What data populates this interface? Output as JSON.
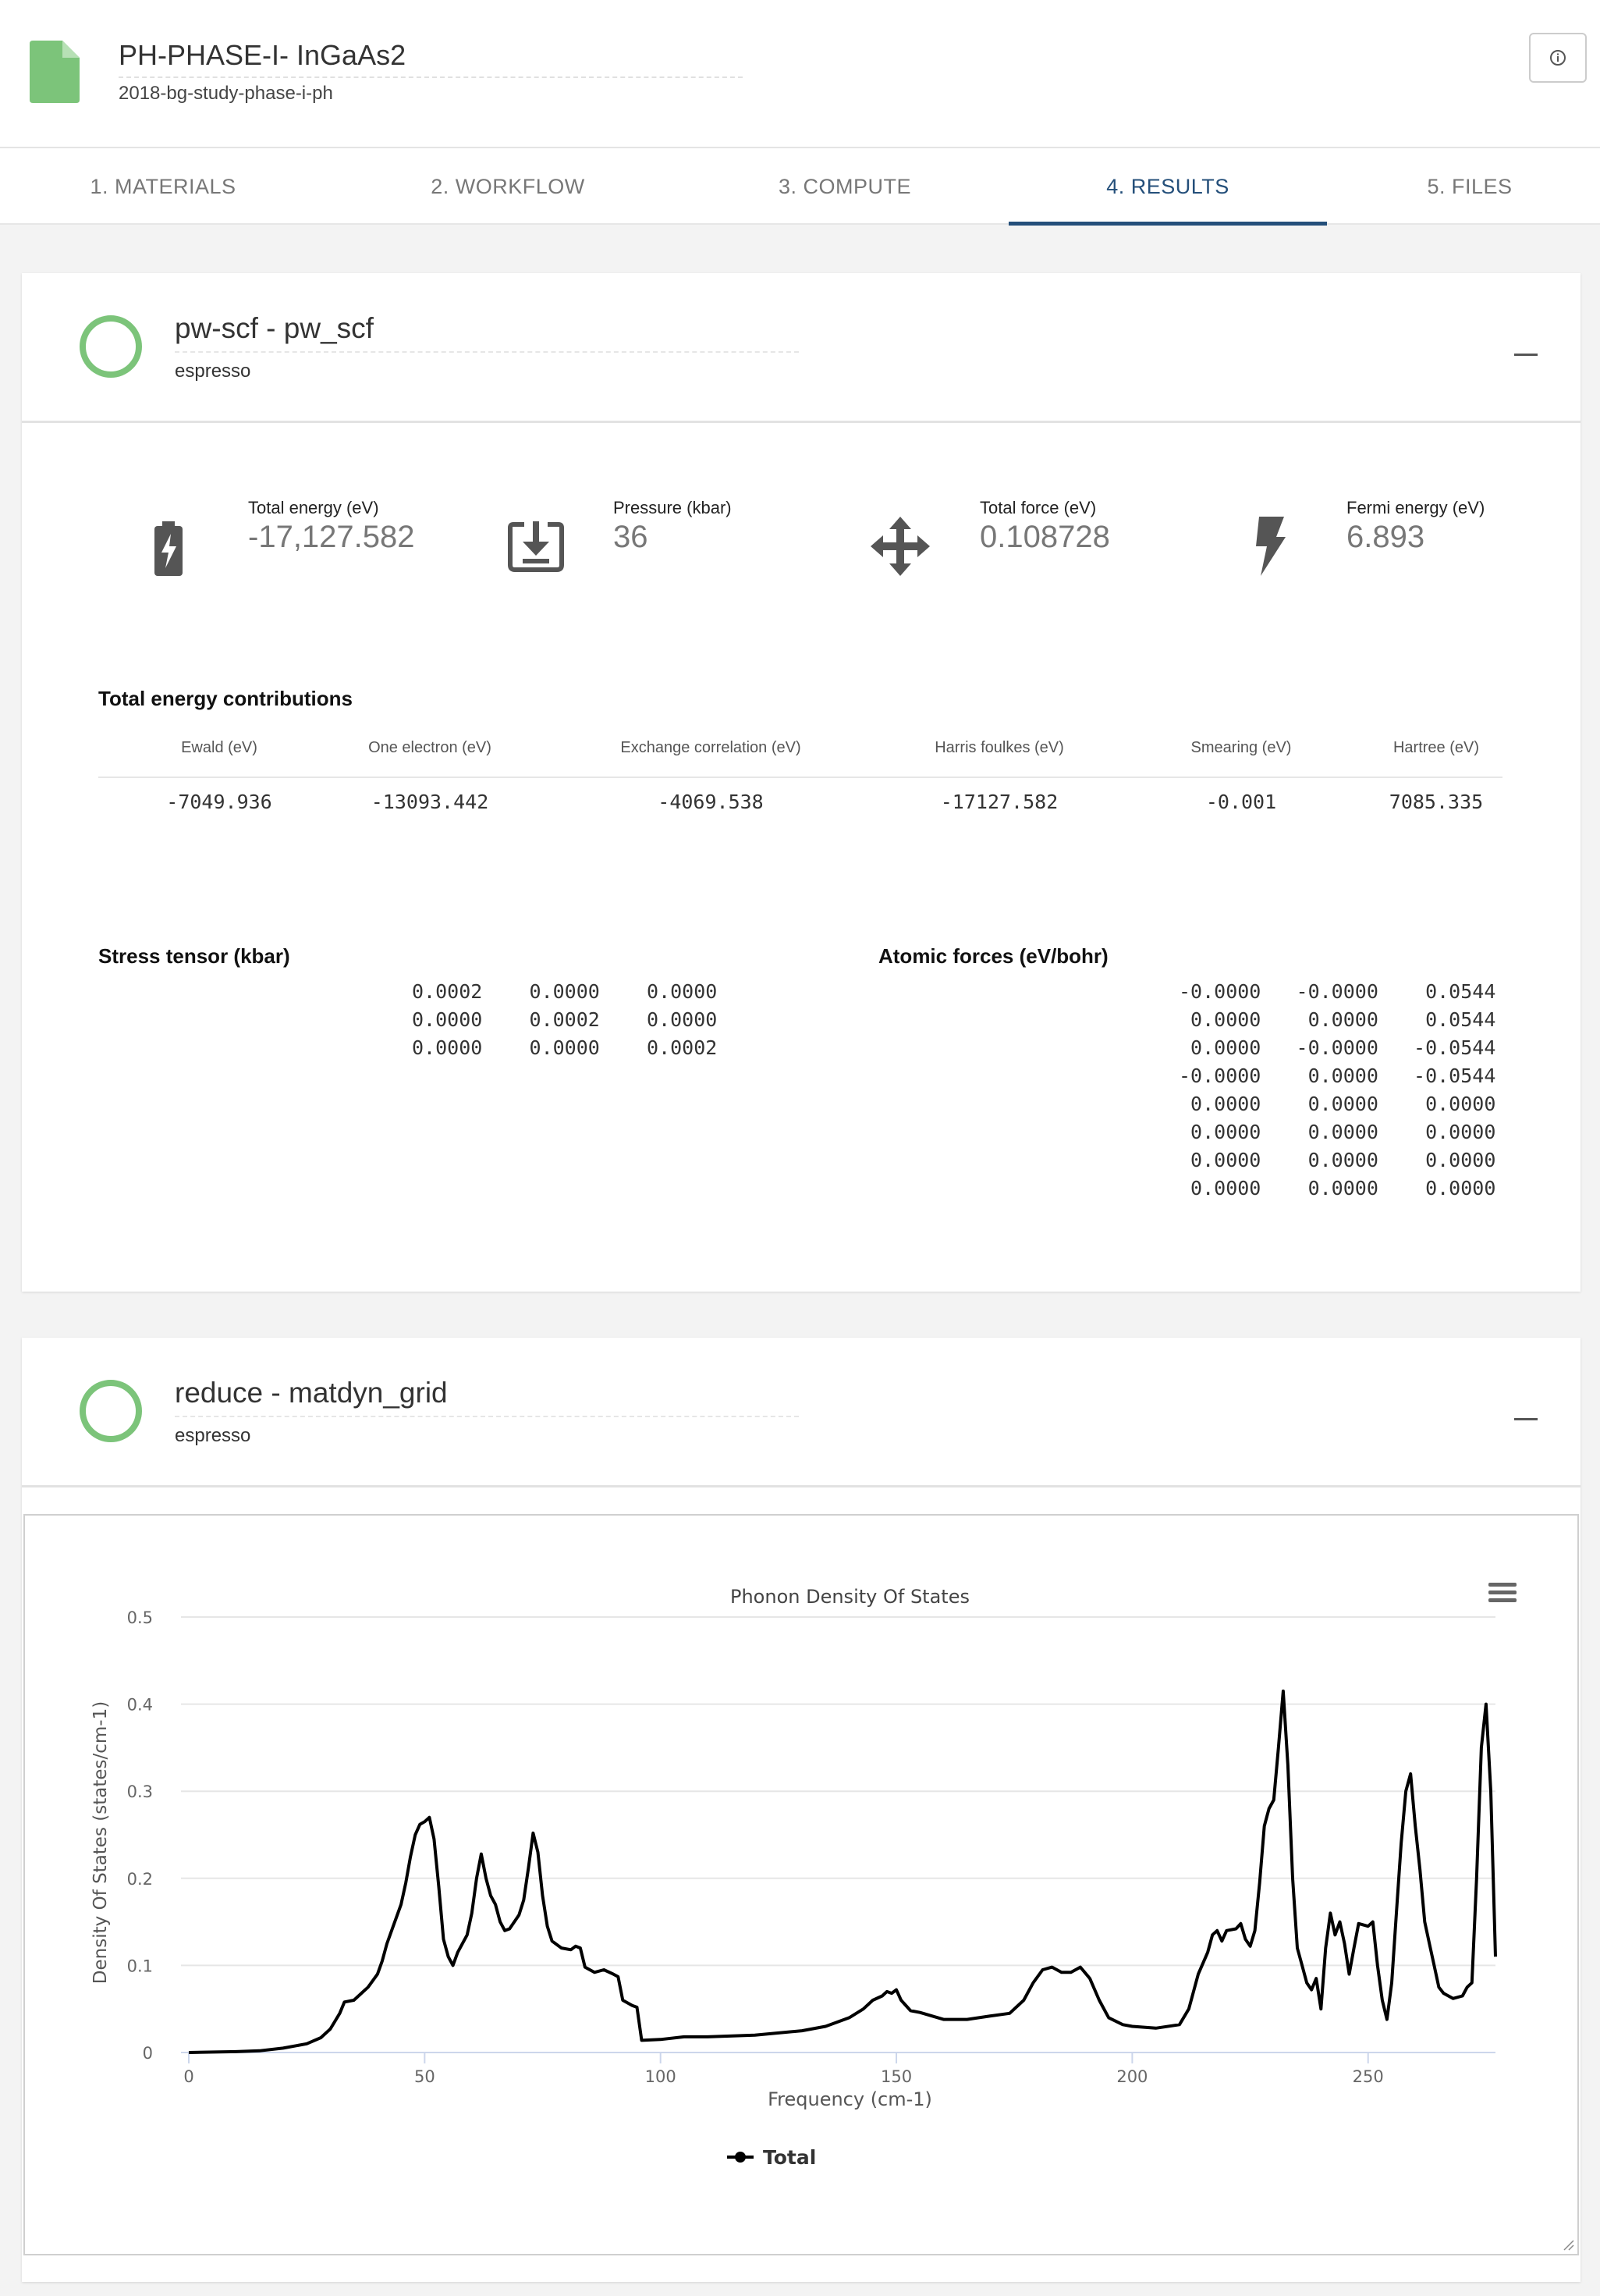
{
  "header": {
    "title": "PH-PHASE-I- InGaAs2",
    "subtitle": "2018-bg-study-phase-i-ph",
    "info_icon": "info-icon"
  },
  "tabs": [
    {
      "label": "1. MATERIALS"
    },
    {
      "label": "2. WORKFLOW"
    },
    {
      "label": "3. COMPUTE"
    },
    {
      "label": "4. RESULTS",
      "active": true
    },
    {
      "label": "5. FILES"
    }
  ],
  "colors": {
    "accent": "#244f7a",
    "status_ok": "#7cc47a",
    "file_icon": "#7cc47a"
  },
  "unit1": {
    "title": "pw-scf - pw_scf",
    "subtitle": "espresso",
    "stats": [
      {
        "label": "Total energy (eV)",
        "value": "-17,127.582",
        "icon": "battery-bolt-icon"
      },
      {
        "label": "Pressure (kbar)",
        "value": "36",
        "icon": "download-box-icon"
      },
      {
        "label": "Total force (eV)",
        "value": "0.108728",
        "icon": "move-arrows-icon"
      },
      {
        "label": "Fermi energy (eV)",
        "value": "6.893",
        "icon": "lightning-icon"
      }
    ],
    "energy_title": "Total energy contributions",
    "energy_headers": [
      "Ewald (eV)",
      "One electron (eV)",
      "Exchange correlation (eV)",
      "Harris foulkes (eV)",
      "Smearing (eV)",
      "Hartree (eV)"
    ],
    "energy_values": [
      "-7049.936",
      "-13093.442",
      "-4069.538",
      "-17127.582",
      "-0.001",
      "7085.335"
    ],
    "stress_title": "Stress tensor (kbar)",
    "stress_rows": [
      "0.0002    0.0000    0.0000",
      "0.0000    0.0002    0.0000",
      "0.0000    0.0000    0.0002"
    ],
    "forces_title": "Atomic forces (eV/bohr)",
    "forces_rows": [
      "-0.0000   -0.0000    0.0544",
      " 0.0000    0.0000    0.0544",
      " 0.0000   -0.0000   -0.0544",
      "-0.0000    0.0000   -0.0544",
      " 0.0000    0.0000    0.0000",
      " 0.0000    0.0000    0.0000",
      " 0.0000    0.0000    0.0000",
      " 0.0000    0.0000    0.0000"
    ]
  },
  "unit2": {
    "title": "reduce - matdyn_grid",
    "subtitle": "espresso"
  },
  "chart_data": {
    "type": "line",
    "title": "Phonon Density Of States",
    "xlabel": "Frequency (cm-1)",
    "ylabel": "Density Of States (states/cm-1)",
    "xlim": [
      0,
      277
    ],
    "ylim": [
      0,
      0.5
    ],
    "x_ticks": [
      "0",
      "50",
      "100",
      "150",
      "200",
      "250"
    ],
    "y_ticks": [
      "0",
      "0.1",
      "0.2",
      "0.3",
      "0.4",
      "0.5"
    ],
    "legend": "bottom-center",
    "grid": true,
    "series": [
      {
        "name": "Total",
        "points": [
          [
            0,
            0
          ],
          [
            10,
            0.001
          ],
          [
            15,
            0.002
          ],
          [
            20,
            0.005
          ],
          [
            25,
            0.01
          ],
          [
            28,
            0.017
          ],
          [
            30,
            0.027
          ],
          [
            32,
            0.045
          ],
          [
            33,
            0.058
          ],
          [
            35,
            0.06
          ],
          [
            37,
            0.07
          ],
          [
            38,
            0.075
          ],
          [
            40,
            0.09
          ],
          [
            41,
            0.105
          ],
          [
            42,
            0.125
          ],
          [
            43,
            0.14
          ],
          [
            45,
            0.17
          ],
          [
            46,
            0.195
          ],
          [
            47,
            0.225
          ],
          [
            48,
            0.25
          ],
          [
            49,
            0.262
          ],
          [
            50,
            0.265
          ],
          [
            51,
            0.27
          ],
          [
            52,
            0.245
          ],
          [
            53,
            0.19
          ],
          [
            54,
            0.13
          ],
          [
            55,
            0.11
          ],
          [
            56,
            0.1
          ],
          [
            57,
            0.115
          ],
          [
            59,
            0.135
          ],
          [
            60,
            0.16
          ],
          [
            61,
            0.2
          ],
          [
            62,
            0.228
          ],
          [
            63,
            0.2
          ],
          [
            64,
            0.18
          ],
          [
            65,
            0.17
          ],
          [
            66,
            0.15
          ],
          [
            67,
            0.14
          ],
          [
            68,
            0.142
          ],
          [
            70,
            0.158
          ],
          [
            71,
            0.175
          ],
          [
            72,
            0.212
          ],
          [
            73,
            0.252
          ],
          [
            74,
            0.23
          ],
          [
            75,
            0.18
          ],
          [
            76,
            0.145
          ],
          [
            77,
            0.128
          ],
          [
            79,
            0.12
          ],
          [
            81,
            0.118
          ],
          [
            82,
            0.122
          ],
          [
            83,
            0.12
          ],
          [
            84,
            0.098
          ],
          [
            86,
            0.092
          ],
          [
            88,
            0.095
          ],
          [
            90,
            0.09
          ],
          [
            91,
            0.087
          ],
          [
            92,
            0.06
          ],
          [
            94,
            0.054
          ],
          [
            95,
            0.052
          ],
          [
            96,
            0.014
          ],
          [
            100,
            0.015
          ],
          [
            105,
            0.018
          ],
          [
            110,
            0.018
          ],
          [
            120,
            0.02
          ],
          [
            130,
            0.025
          ],
          [
            135,
            0.03
          ],
          [
            140,
            0.04
          ],
          [
            143,
            0.05
          ],
          [
            145,
            0.06
          ],
          [
            147,
            0.065
          ],
          [
            148,
            0.07
          ],
          [
            149,
            0.068
          ],
          [
            150,
            0.072
          ],
          [
            151,
            0.06
          ],
          [
            153,
            0.048
          ],
          [
            155,
            0.046
          ],
          [
            160,
            0.038
          ],
          [
            165,
            0.038
          ],
          [
            170,
            0.042
          ],
          [
            174,
            0.045
          ],
          [
            177,
            0.06
          ],
          [
            179,
            0.08
          ],
          [
            181,
            0.095
          ],
          [
            183,
            0.098
          ],
          [
            185,
            0.092
          ],
          [
            187,
            0.092
          ],
          [
            189,
            0.098
          ],
          [
            191,
            0.085
          ],
          [
            193,
            0.06
          ],
          [
            195,
            0.04
          ],
          [
            198,
            0.032
          ],
          [
            200,
            0.03
          ],
          [
            205,
            0.028
          ],
          [
            210,
            0.032
          ],
          [
            212,
            0.05
          ],
          [
            214,
            0.09
          ],
          [
            216,
            0.115
          ],
          [
            217,
            0.135
          ],
          [
            218,
            0.14
          ],
          [
            219,
            0.128
          ],
          [
            220,
            0.14
          ],
          [
            222,
            0.142
          ],
          [
            223,
            0.148
          ],
          [
            224,
            0.13
          ],
          [
            225,
            0.122
          ],
          [
            226,
            0.14
          ],
          [
            227,
            0.195
          ],
          [
            228,
            0.26
          ],
          [
            229,
            0.28
          ],
          [
            230,
            0.29
          ],
          [
            231,
            0.35
          ],
          [
            232,
            0.415
          ],
          [
            233,
            0.33
          ],
          [
            234,
            0.2
          ],
          [
            235,
            0.12
          ],
          [
            236,
            0.1
          ],
          [
            237,
            0.08
          ],
          [
            238,
            0.072
          ],
          [
            239,
            0.085
          ],
          [
            240,
            0.05
          ],
          [
            241,
            0.12
          ],
          [
            242,
            0.16
          ],
          [
            243,
            0.135
          ],
          [
            244,
            0.15
          ],
          [
            245,
            0.125
          ],
          [
            246,
            0.09
          ],
          [
            247,
            0.12
          ],
          [
            248,
            0.148
          ],
          [
            250,
            0.145
          ],
          [
            251,
            0.15
          ],
          [
            252,
            0.1
          ],
          [
            253,
            0.06
          ],
          [
            254,
            0.038
          ],
          [
            255,
            0.08
          ],
          [
            256,
            0.16
          ],
          [
            257,
            0.24
          ],
          [
            258,
            0.3
          ],
          [
            259,
            0.32
          ],
          [
            260,
            0.26
          ],
          [
            261,
            0.21
          ],
          [
            262,
            0.15
          ],
          [
            263,
            0.125
          ],
          [
            264,
            0.1
          ],
          [
            265,
            0.075
          ],
          [
            266,
            0.068
          ],
          [
            268,
            0.062
          ],
          [
            270,
            0.065
          ],
          [
            271,
            0.075
          ],
          [
            272,
            0.08
          ],
          [
            273,
            0.2
          ],
          [
            274,
            0.35
          ],
          [
            275,
            0.4
          ],
          [
            276,
            0.3
          ],
          [
            277,
            0.11
          ]
        ]
      }
    ]
  }
}
